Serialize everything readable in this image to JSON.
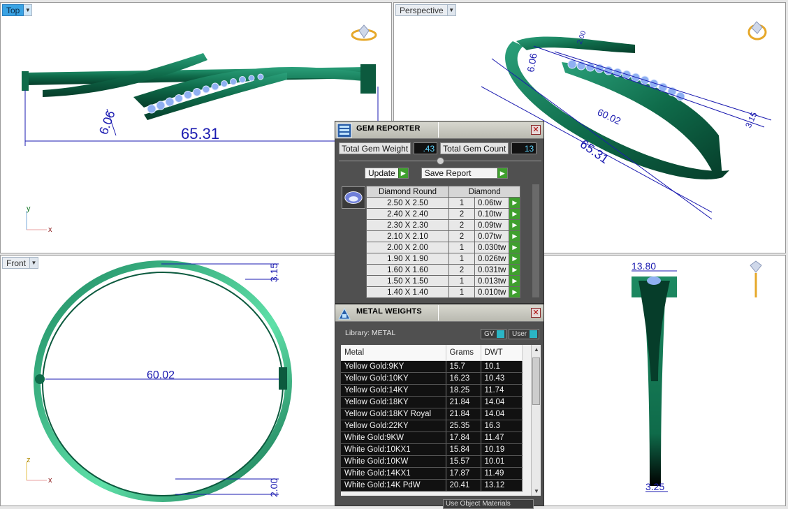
{
  "viewports": {
    "top": {
      "label": "Top",
      "dim_main": "65.31",
      "dim_small": "6.06",
      "axis_y": "y",
      "axis_x": "x"
    },
    "perspective": {
      "label": "Perspective",
      "dim_a": "6.06",
      "dim_b": "65.31",
      "dim_c": "60.02",
      "dim_d": "3.15",
      "dim_e": "2.00"
    },
    "front": {
      "label": "Front",
      "dim_width": "60.02",
      "dim_top": "3.15",
      "dim_bottom": "2.00",
      "axis_z": "z",
      "axis_x": "x"
    },
    "right": {
      "dim_top": "13.80",
      "dim_bottom": "3.25"
    }
  },
  "gem_reporter": {
    "title": "GEM REPORTER",
    "total_weight_label": "Total Gem Weight",
    "total_weight_value": ".43",
    "total_count_label": "Total Gem Count",
    "total_count_value": "13",
    "update_label": "Update",
    "save_report_label": "Save Report",
    "table_header": [
      "Diamond Round",
      "Diamond"
    ],
    "rows": [
      {
        "size": "2.50 X 2.50",
        "count": "1",
        "tw": "0.06tw"
      },
      {
        "size": "2.40 X 2.40",
        "count": "2",
        "tw": "0.10tw"
      },
      {
        "size": "2.30 X 2.30",
        "count": "2",
        "tw": "0.09tw"
      },
      {
        "size": "2.10 X 2.10",
        "count": "2",
        "tw": "0.07tw"
      },
      {
        "size": "2.00 X 2.00",
        "count": "1",
        "tw": "0.030tw"
      },
      {
        "size": "1.90 X 1.90",
        "count": "1",
        "tw": "0.026tw"
      },
      {
        "size": "1.60 X 1.60",
        "count": "2",
        "tw": "0.031tw"
      },
      {
        "size": "1.50 X 1.50",
        "count": "1",
        "tw": "0.013tw"
      },
      {
        "size": "1.40 X 1.40",
        "count": "1",
        "tw": "0.010tw"
      }
    ]
  },
  "metal_weights": {
    "title": "METAL WEIGHTS",
    "library_label": "Library: METAL",
    "gv_label": "GV",
    "user_label": "User",
    "columns": [
      "Metal",
      "Grams",
      "DWT"
    ],
    "rows": [
      {
        "metal": "Yellow Gold:9KY",
        "grams": "15.7",
        "dwt": "10.1"
      },
      {
        "metal": "Yellow Gold:10KY",
        "grams": "16.23",
        "dwt": "10.43"
      },
      {
        "metal": "Yellow Gold:14KY",
        "grams": "18.25",
        "dwt": "11.74"
      },
      {
        "metal": "Yellow Gold:18KY",
        "grams": "21.84",
        "dwt": "14.04"
      },
      {
        "metal": "Yellow Gold:18KY Royal",
        "grams": "21.84",
        "dwt": "14.04"
      },
      {
        "metal": "Yellow Gold:22KY",
        "grams": "25.35",
        "dwt": "16.3"
      },
      {
        "metal": "White Gold:9KW",
        "grams": "17.84",
        "dwt": "11.47"
      },
      {
        "metal": "White Gold:10KX1",
        "grams": "15.84",
        "dwt": "10.19"
      },
      {
        "metal": "White Gold:10KW",
        "grams": "15.57",
        "dwt": "10.01"
      },
      {
        "metal": "White Gold:14KX1",
        "grams": "17.87",
        "dwt": "11.49"
      },
      {
        "metal": "White Gold:14K PdW",
        "grams": "20.41",
        "dwt": "13.12"
      }
    ],
    "use_object_materials_label": "Use Object Materials"
  },
  "colors": {
    "metal": "#0f6b4a",
    "gem": "#8fb0f2",
    "dimension": "#1a1ab0",
    "active_tab": "#3aa3e3"
  }
}
